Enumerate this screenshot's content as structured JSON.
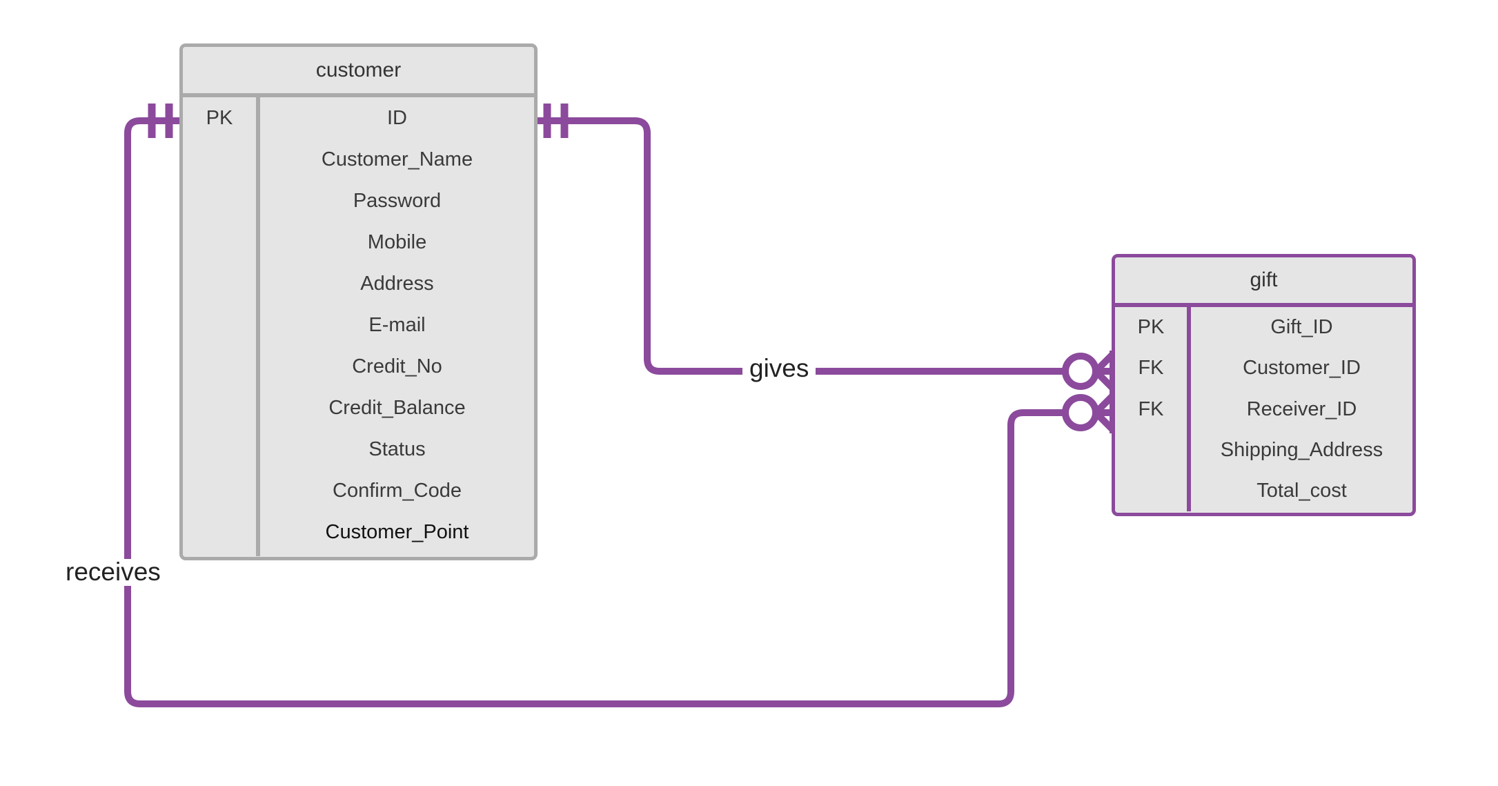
{
  "diagram": {
    "type": "entity-relationship-diagram",
    "notation": "crow's foot",
    "colors": {
      "purple": "#8b4a9c",
      "gray_border": "#aaaaaa",
      "entity_fill": "#e5e5e5",
      "text": "#3a3a3a",
      "background": "#ffffff"
    }
  },
  "entities": [
    {
      "id": "customer",
      "title": "customer",
      "border_style": "gray",
      "rows": [
        {
          "key": "PK",
          "attribute": "ID"
        },
        {
          "key": "",
          "attribute": "Customer_Name"
        },
        {
          "key": "",
          "attribute": "Password"
        },
        {
          "key": "",
          "attribute": "Mobile"
        },
        {
          "key": "",
          "attribute": "Address"
        },
        {
          "key": "",
          "attribute": "E-mail"
        },
        {
          "key": "",
          "attribute": "Credit_No"
        },
        {
          "key": "",
          "attribute": "Credit_Balance"
        },
        {
          "key": "",
          "attribute": "Status"
        },
        {
          "key": "",
          "attribute": "Confirm_Code"
        },
        {
          "key": "",
          "attribute": "Customer_Point",
          "emphasis": true
        }
      ]
    },
    {
      "id": "gift",
      "title": "gift",
      "border_style": "purple",
      "rows": [
        {
          "key": "PK",
          "attribute": "Gift_ID"
        },
        {
          "key": "FK",
          "attribute": "Customer_ID"
        },
        {
          "key": "FK",
          "attribute": "Receiver_ID"
        },
        {
          "key": "",
          "attribute": "Shipping_Address"
        },
        {
          "key": "",
          "attribute": "Total_cost"
        }
      ]
    }
  ],
  "relationships": [
    {
      "id": "gives",
      "label": "gives",
      "from": "customer",
      "to": "gift",
      "from_cardinality": "exactly-one",
      "to_cardinality": "zero-or-many",
      "to_attribute": "Customer_ID"
    },
    {
      "id": "receives",
      "label": "receives",
      "from": "customer",
      "to": "gift",
      "from_cardinality": "exactly-one",
      "to_cardinality": "zero-or-many",
      "to_attribute": "Receiver_ID"
    }
  ]
}
